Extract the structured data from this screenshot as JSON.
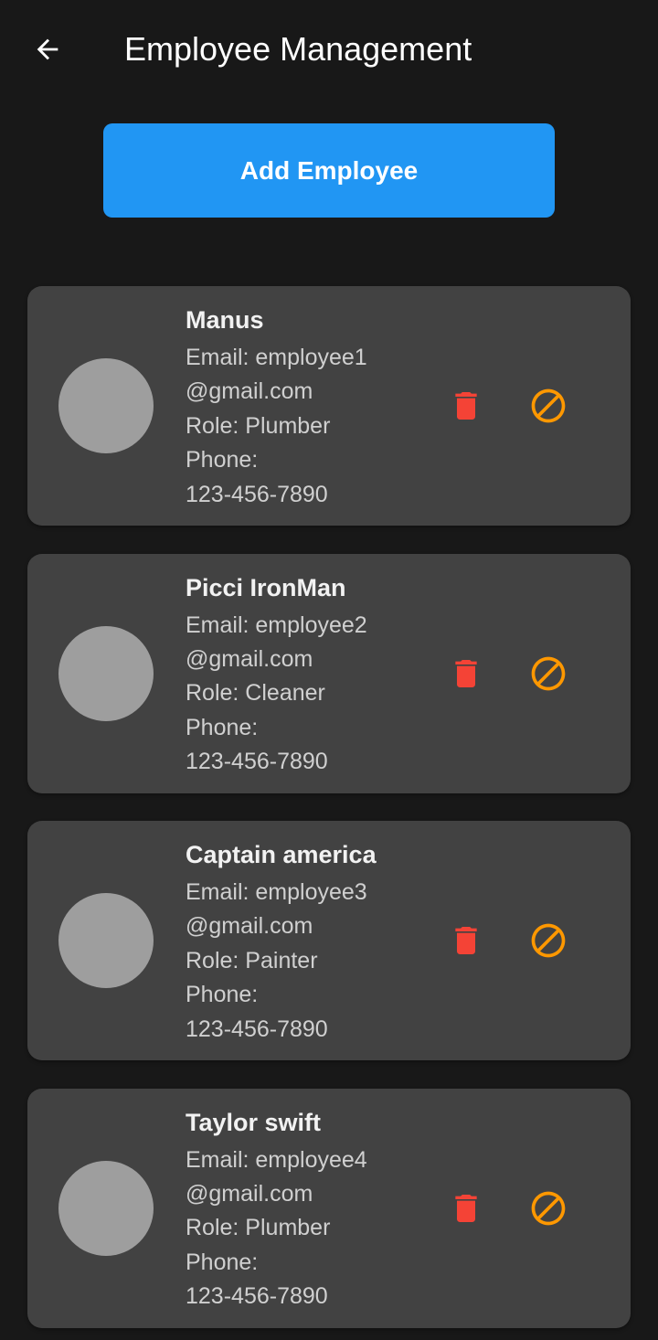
{
  "header": {
    "title": "Employee Management",
    "back_icon": "arrow-left-icon"
  },
  "actions": {
    "add_label": "Add Employee"
  },
  "colors": {
    "background": "#181818",
    "card": "#424242",
    "accent": "#2196F3",
    "avatar": "#9E9E9E",
    "delete": "#F44336",
    "block": "#FF9800"
  },
  "icons": {
    "delete": "trash-icon",
    "block": "block-icon"
  },
  "employees": [
    {
      "name": "Manus",
      "email_line1": "Email: employee1",
      "email_line2": "@gmail.com",
      "role": "Role: Plumber",
      "phone_label": "Phone:",
      "phone": "123-456-7890"
    },
    {
      "name": "Picci IronMan",
      "email_line1": "Email: employee2",
      "email_line2": "@gmail.com",
      "role": "Role: Cleaner",
      "phone_label": "Phone:",
      "phone": "123-456-7890"
    },
    {
      "name": "Captain america",
      "email_line1": "Email: employee3",
      "email_line2": "@gmail.com",
      "role": "Role: Painter",
      "phone_label": "Phone:",
      "phone": "123-456-7890"
    },
    {
      "name": "Taylor swift",
      "email_line1": "Email: employee4",
      "email_line2": "@gmail.com",
      "role": "Role: Plumber",
      "phone_label": "Phone:",
      "phone": "123-456-7890"
    }
  ]
}
